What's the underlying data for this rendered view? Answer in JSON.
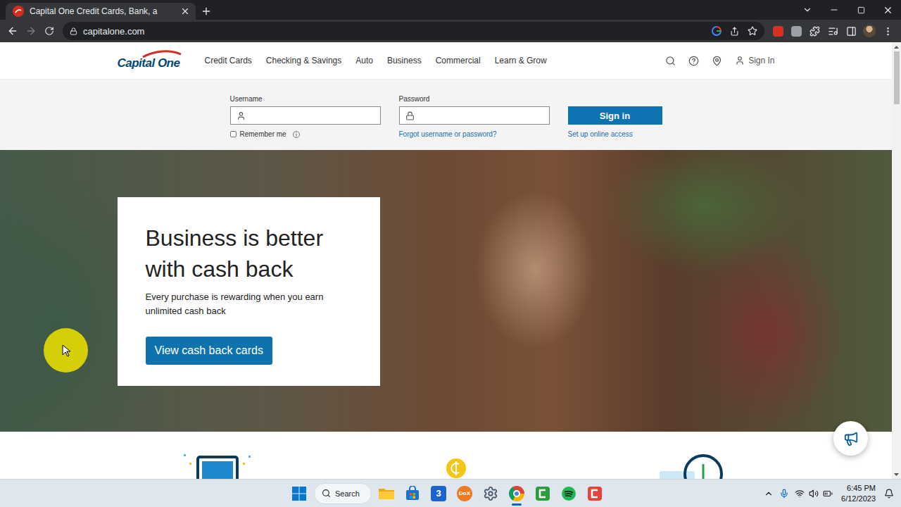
{
  "browser": {
    "tabs": [
      {
        "title": "Capital One Credit Cards, Bank, a",
        "selected": true
      }
    ],
    "url": "capitalone.com"
  },
  "site": {
    "logo": "Capital One",
    "nav": [
      "Credit Cards",
      "Checking & Savings",
      "Auto",
      "Business",
      "Commercial",
      "Learn & Grow"
    ],
    "sign_in_link": "Sign In",
    "login": {
      "username_label": "Username",
      "password_label": "Password",
      "button": "Sign in",
      "remember_me": {
        "label": "Remember me",
        "checked": false
      },
      "forgot": "Forgot username or password?",
      "setup": "Set up online access"
    },
    "hero": {
      "title": "Business is better with cash back",
      "subtitle": "Every purchase is rewarding when you earn unlimited cash back",
      "button": "View cash back cards"
    }
  },
  "taskbar": {
    "search": "Search",
    "apps": [
      {
        "kind": "explorer",
        "selected": false,
        "running": false
      },
      {
        "kind": "store",
        "selected": false,
        "running": false
      },
      {
        "kind": "badge",
        "label": "3",
        "selected": false,
        "running": false
      },
      {
        "kind": "dox",
        "label": "DoX",
        "selected": false,
        "running": false
      },
      {
        "kind": "settings",
        "selected": false,
        "running": false
      },
      {
        "kind": "chrome",
        "selected": true,
        "running": true
      },
      {
        "kind": "camtasia",
        "selected": false,
        "running": false
      },
      {
        "kind": "spotify",
        "selected": false,
        "running": false
      },
      {
        "kind": "recorder",
        "selected": false,
        "running": false
      }
    ],
    "time": "6:45 PM",
    "date": "6/12/2023"
  }
}
